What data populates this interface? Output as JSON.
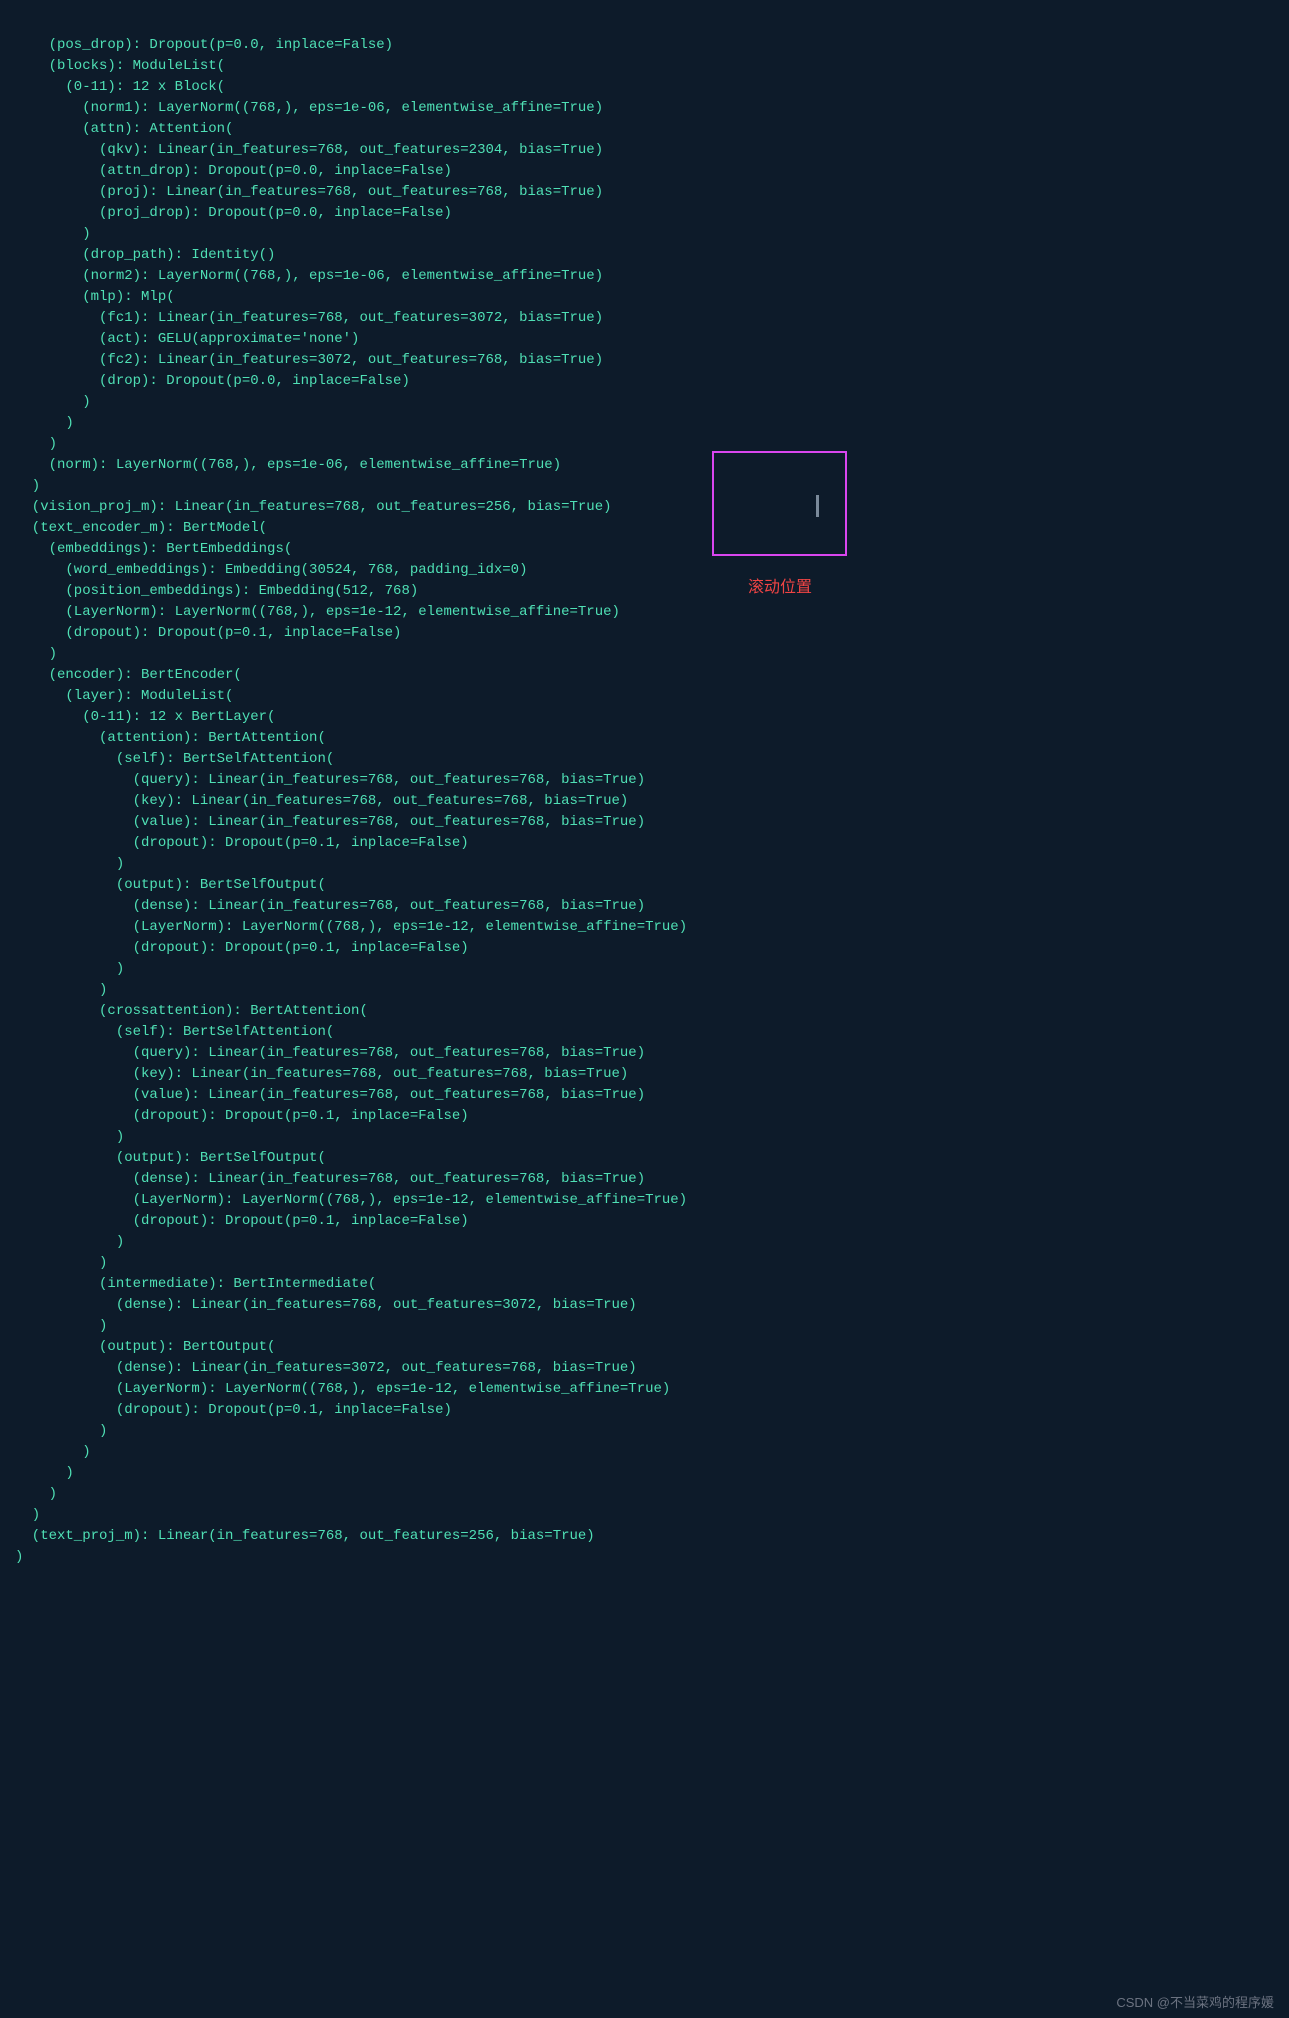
{
  "code": "    (pos_drop): Dropout(p=0.0, inplace=False)\n    (blocks): ModuleList(\n      (0-11): 12 x Block(\n        (norm1): LayerNorm((768,), eps=1e-06, elementwise_affine=True)\n        (attn): Attention(\n          (qkv): Linear(in_features=768, out_features=2304, bias=True)\n          (attn_drop): Dropout(p=0.0, inplace=False)\n          (proj): Linear(in_features=768, out_features=768, bias=True)\n          (proj_drop): Dropout(p=0.0, inplace=False)\n        )\n        (drop_path): Identity()\n        (norm2): LayerNorm((768,), eps=1e-06, elementwise_affine=True)\n        (mlp): Mlp(\n          (fc1): Linear(in_features=768, out_features=3072, bias=True)\n          (act): GELU(approximate='none')\n          (fc2): Linear(in_features=3072, out_features=768, bias=True)\n          (drop): Dropout(p=0.0, inplace=False)\n        )\n      )\n    )\n    (norm): LayerNorm((768,), eps=1e-06, elementwise_affine=True)\n  )\n  (vision_proj_m): Linear(in_features=768, out_features=256, bias=True)\n  (text_encoder_m): BertModel(\n    (embeddings): BertEmbeddings(\n      (word_embeddings): Embedding(30524, 768, padding_idx=0)\n      (position_embeddings): Embedding(512, 768)\n      (LayerNorm): LayerNorm((768,), eps=1e-12, elementwise_affine=True)\n      (dropout): Dropout(p=0.1, inplace=False)\n    )\n    (encoder): BertEncoder(\n      (layer): ModuleList(\n        (0-11): 12 x BertLayer(\n          (attention): BertAttention(\n            (self): BertSelfAttention(\n              (query): Linear(in_features=768, out_features=768, bias=True)\n              (key): Linear(in_features=768, out_features=768, bias=True)\n              (value): Linear(in_features=768, out_features=768, bias=True)\n              (dropout): Dropout(p=0.1, inplace=False)\n            )\n            (output): BertSelfOutput(\n              (dense): Linear(in_features=768, out_features=768, bias=True)\n              (LayerNorm): LayerNorm((768,), eps=1e-12, elementwise_affine=True)\n              (dropout): Dropout(p=0.1, inplace=False)\n            )\n          )\n          (crossattention): BertAttention(\n            (self): BertSelfAttention(\n              (query): Linear(in_features=768, out_features=768, bias=True)\n              (key): Linear(in_features=768, out_features=768, bias=True)\n              (value): Linear(in_features=768, out_features=768, bias=True)\n              (dropout): Dropout(p=0.1, inplace=False)\n            )\n            (output): BertSelfOutput(\n              (dense): Linear(in_features=768, out_features=768, bias=True)\n              (LayerNorm): LayerNorm((768,), eps=1e-12, elementwise_affine=True)\n              (dropout): Dropout(p=0.1, inplace=False)\n            )\n          )\n          (intermediate): BertIntermediate(\n            (dense): Linear(in_features=768, out_features=3072, bias=True)\n          )\n          (output): BertOutput(\n            (dense): Linear(in_features=3072, out_features=768, bias=True)\n            (LayerNorm): LayerNorm((768,), eps=1e-12, elementwise_affine=True)\n            (dropout): Dropout(p=0.1, inplace=False)\n          )\n        )\n      )\n    )\n  )\n  (text_proj_m): Linear(in_features=768, out_features=256, bias=True)\n)",
  "annotation_label": "滚动位置",
  "watermark": "CSDN @不当菜鸡的程序媛"
}
